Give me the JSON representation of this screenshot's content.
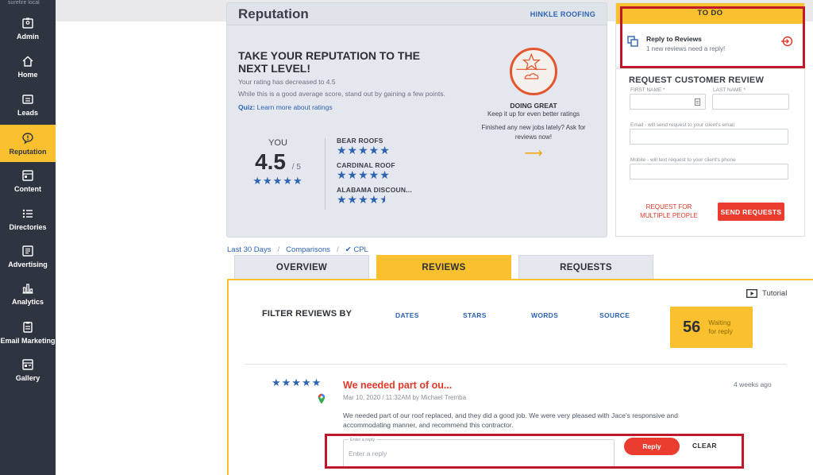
{
  "sidebar": {
    "brand": "surefire local",
    "items": [
      {
        "label": "Admin",
        "icon": "admin-icon"
      },
      {
        "label": "Home",
        "icon": "home-icon"
      },
      {
        "label": "Leads",
        "icon": "leads-icon"
      },
      {
        "label": "Reputation",
        "icon": "reputation-icon",
        "active": true
      },
      {
        "label": "Content",
        "icon": "content-icon"
      },
      {
        "label": "Directories",
        "icon": "directories-icon"
      },
      {
        "label": "Advertising",
        "icon": "advertising-icon"
      },
      {
        "label": "Analytics",
        "icon": "analytics-icon"
      },
      {
        "label": "Email Marketing",
        "icon": "email-marketing-icon"
      },
      {
        "label": "Gallery",
        "icon": "gallery-icon"
      }
    ]
  },
  "reputation": {
    "title": "Reputation",
    "company": "HINKLE ROOFING",
    "headline": "TAKE YOUR REPUTATION TO THE NEXT LEVEL!",
    "decrease_text": "Your rating has decreased to 4.5",
    "advice_text": "While this is a good average score, stand out by gaining a few points.",
    "quiz_label": "Quiz:",
    "quiz_link": "Learn more about ratings",
    "you_label": "YOU",
    "score": "4.5",
    "score_max": "/ 5",
    "you_rating": 5,
    "competitors": [
      {
        "name": "BEAR ROOFS",
        "rating": 5
      },
      {
        "name": "CARDINAL ROOF",
        "rating": 5
      },
      {
        "name": "ALABAMA DISCOUN...",
        "rating": 4.5
      }
    ],
    "status_title": "DOING GREAT",
    "status_sub": "Keep it up for even better ratings",
    "status_cta": "Finished any new jobs lately? Ask for reviews now!"
  },
  "todo": {
    "header": "TO DO",
    "item_title": "Reply to Reviews",
    "item_sub": "1 new reviews need a reply!"
  },
  "request": {
    "title": "REQUEST CUSTOMER REVIEW",
    "first_name_label": "FIRST NAME *",
    "last_name_label": "LAST NAME *",
    "email_label": "Email - will send request to your client's email",
    "mobile_label": "Mobile - will text request to your client's phone",
    "multiple_label": "REQUEST FOR MULTIPLE PEOPLE",
    "send_label": "SEND REQUESTS"
  },
  "crumbs": {
    "range": "Last 30 Days",
    "comparisons": "Comparisons",
    "cpl": "CPL"
  },
  "tabs": [
    {
      "label": "OVERVIEW"
    },
    {
      "label": "REVIEWS",
      "active": true
    },
    {
      "label": "REQUESTS"
    }
  ],
  "reviews": {
    "tutorial": "Tutorial",
    "filter_label": "FILTER REVIEWS BY",
    "filters": [
      "DATES",
      "STARS",
      "WORDS",
      "SOURCE"
    ],
    "waiting_count": "56",
    "waiting_label": "Waiting for reply",
    "item": {
      "rating": 5,
      "title": "We needed part of ou...",
      "date": "Mar 10, 2020 / 11:32AM by Michael Tremba",
      "ago": "4 weeks ago",
      "body": "We needed part of our roof replaced, and they did a good job. We were very pleased with Jace's responsive and accommodating manner, and recommend this contractor.",
      "reply_tiny": "Enter a reply",
      "reply_placeholder": "Enter a reply",
      "reply_label": "Reply",
      "clear_label": "CLEAR"
    }
  },
  "colors": {
    "sidebar_bg": "#2f3540",
    "accent_yellow": "#fbc02d",
    "action_red": "#ea3d2f",
    "link_blue": "#2e63b0",
    "highlight_box": "#c0182b"
  }
}
